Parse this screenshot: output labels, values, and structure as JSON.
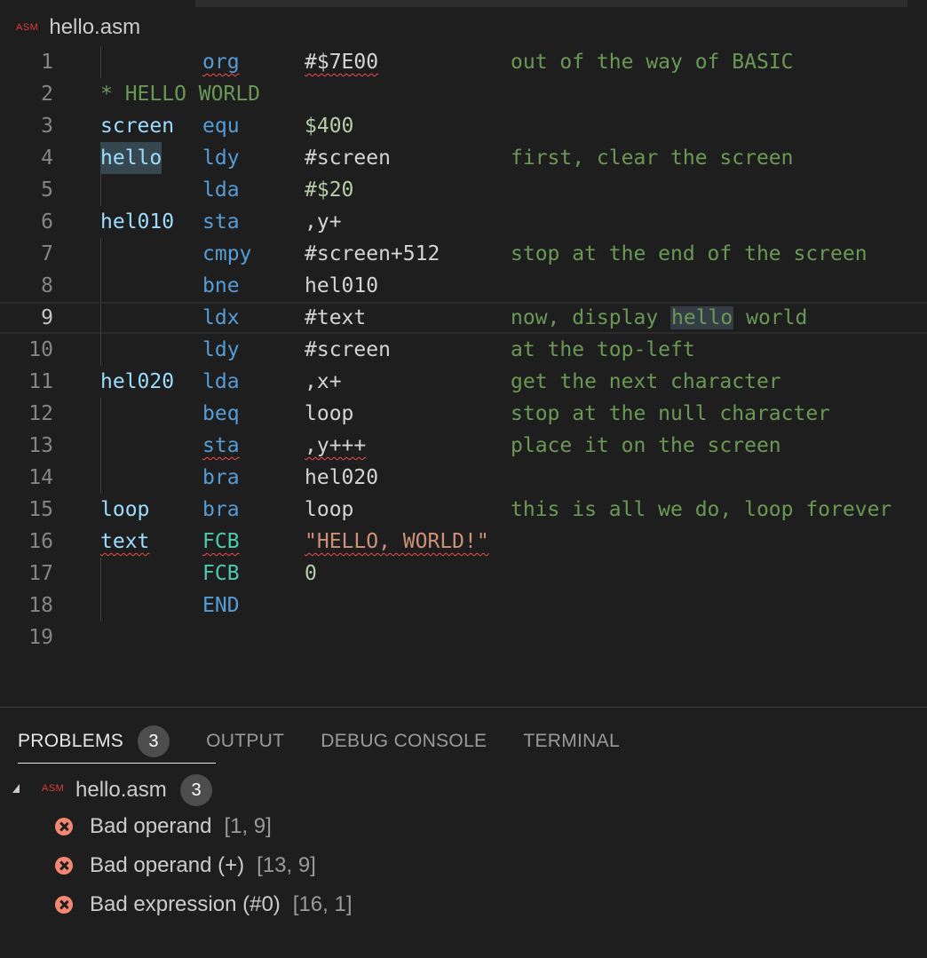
{
  "file_tab": {
    "badge": "ASM",
    "name": "hello.asm"
  },
  "editor": {
    "current_line": 9,
    "lines": [
      {
        "n": "1",
        "label": "",
        "op": "org",
        "arg": "#$7E00",
        "comment": "out of the way of BASIC"
      },
      {
        "n": "2",
        "full_comment": "* HELLO WORLD"
      },
      {
        "n": "3",
        "label": "screen",
        "op": "equ",
        "arg": "$400",
        "comment": ""
      },
      {
        "n": "4",
        "label": "hello",
        "op": "ldy",
        "arg": "#screen",
        "comment": "first, clear the screen"
      },
      {
        "n": "5",
        "label": "",
        "op": "lda",
        "arg": "#$20",
        "comment": ""
      },
      {
        "n": "6",
        "label": "hel010",
        "op": "sta",
        "arg": ",y+",
        "comment": ""
      },
      {
        "n": "7",
        "label": "",
        "op": "cmpy",
        "arg": "#screen+512",
        "comment": "stop at the end of the screen"
      },
      {
        "n": "8",
        "label": "",
        "op": "bne",
        "arg": "hel010",
        "comment": ""
      },
      {
        "n": "9",
        "label": "",
        "op": "ldx",
        "arg": "#text",
        "comment_pre": "now, display ",
        "comment_hl": "hello",
        "comment_post": " world"
      },
      {
        "n": "10",
        "label": "",
        "op": "ldy",
        "arg": "#screen",
        "comment": "at the top-left"
      },
      {
        "n": "11",
        "label": "hel020",
        "op": "lda",
        "arg": ",x+",
        "comment": "get the next character"
      },
      {
        "n": "12",
        "label": "",
        "op": "beq",
        "arg": "loop",
        "comment": "stop at the null character"
      },
      {
        "n": "13",
        "label": "",
        "op": "sta",
        "arg": ",y+++",
        "comment": "place it on the screen"
      },
      {
        "n": "14",
        "label": "",
        "op": "bra",
        "arg": "hel020",
        "comment": ""
      },
      {
        "n": "15",
        "label": "loop",
        "op": "bra",
        "arg": "loop",
        "comment": "this is all we do, loop forever"
      },
      {
        "n": "16",
        "label": "text",
        "op": "FCB",
        "arg": "\"HELLO, WORLD!\"",
        "comment": ""
      },
      {
        "n": "17",
        "label": "",
        "op": "FCB",
        "arg": "0",
        "comment": ""
      },
      {
        "n": "18",
        "label": "",
        "op": "END",
        "arg": "",
        "comment": ""
      },
      {
        "n": "19"
      }
    ]
  },
  "panel": {
    "tabs": [
      {
        "label": "PROBLEMS",
        "count": "3"
      },
      {
        "label": "OUTPUT"
      },
      {
        "label": "DEBUG CONSOLE"
      },
      {
        "label": "TERMINAL"
      }
    ],
    "file": {
      "badge": "ASM",
      "name": "hello.asm",
      "count": "3"
    },
    "problems": [
      {
        "message": "Bad operand",
        "position": "[1, 9]"
      },
      {
        "message": "Bad operand (+)",
        "position": "[13, 9]"
      },
      {
        "message": "Bad expression (#0)",
        "position": "[16, 1]"
      }
    ]
  },
  "colors": {
    "error": "#f48771",
    "squiggle": "#f14c4c",
    "comment": "#6a9955",
    "keyword": "#569cd6",
    "label": "#9cdcfe"
  }
}
